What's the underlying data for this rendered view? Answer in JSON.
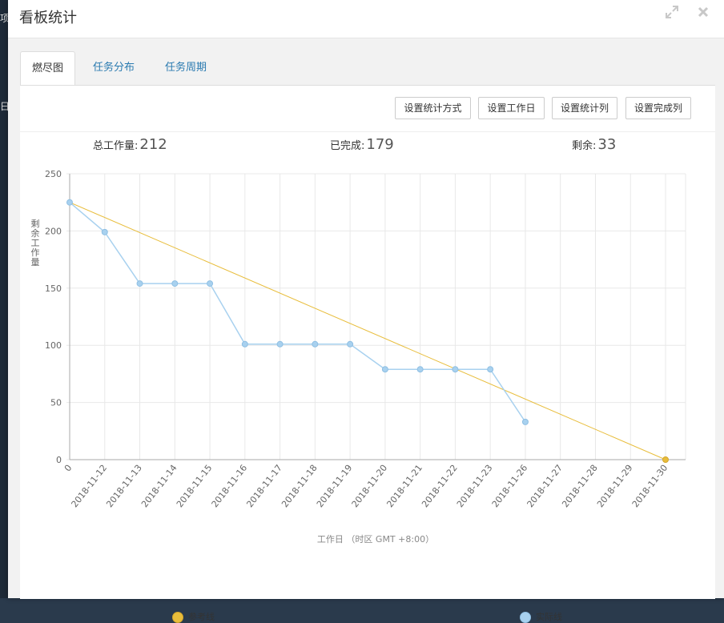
{
  "background": {
    "line1": "项目",
    "line2": "日"
  },
  "modal": {
    "title": "看板统计",
    "expand_icon": "expand-icon",
    "close_icon": "close-icon"
  },
  "tabs": [
    {
      "label": "燃尽图",
      "active": true
    },
    {
      "label": "任务分布",
      "active": false
    },
    {
      "label": "任务周期",
      "active": false
    }
  ],
  "toolbar": {
    "stat_method": "设置统计方式",
    "workday": "设置工作日",
    "stat_column": "设置统计列",
    "done_column": "设置完成列"
  },
  "stats": {
    "total_label": "总工作量:",
    "total_value": "212",
    "done_label": "已完成:",
    "done_value": "179",
    "remaining_label": "剩余:",
    "remaining_value": "33"
  },
  "chart_data": {
    "type": "line",
    "categories": [
      "0",
      "2018-11-12",
      "2018-11-13",
      "2018-11-14",
      "2018-11-15",
      "2018-11-16",
      "2018-11-17",
      "2018-11-18",
      "2018-11-19",
      "2018-11-20",
      "2018-11-21",
      "2018-11-22",
      "2018-11-23",
      "2018-11-26",
      "2018-11-27",
      "2018-11-28",
      "2018-11-29",
      "2018-11-30"
    ],
    "ylim": [
      0,
      250
    ],
    "yticks": [
      0,
      50,
      100,
      150,
      200,
      250
    ],
    "ylabel": "剩余工作量",
    "xlabel": "工作日 （时区 GMT +8:00）",
    "grid": true,
    "series": [
      {
        "name": "参考线",
        "color": "#e8bd3b",
        "values": [
          225,
          null,
          null,
          null,
          null,
          null,
          null,
          null,
          null,
          null,
          null,
          null,
          null,
          null,
          null,
          null,
          null,
          0
        ]
      },
      {
        "name": "实际线",
        "color": "#a8d1ef",
        "values": [
          225,
          199,
          154,
          154,
          154,
          101,
          101,
          101,
          101,
          79,
          79,
          79,
          79,
          33,
          null,
          null,
          null,
          null
        ]
      }
    ]
  }
}
